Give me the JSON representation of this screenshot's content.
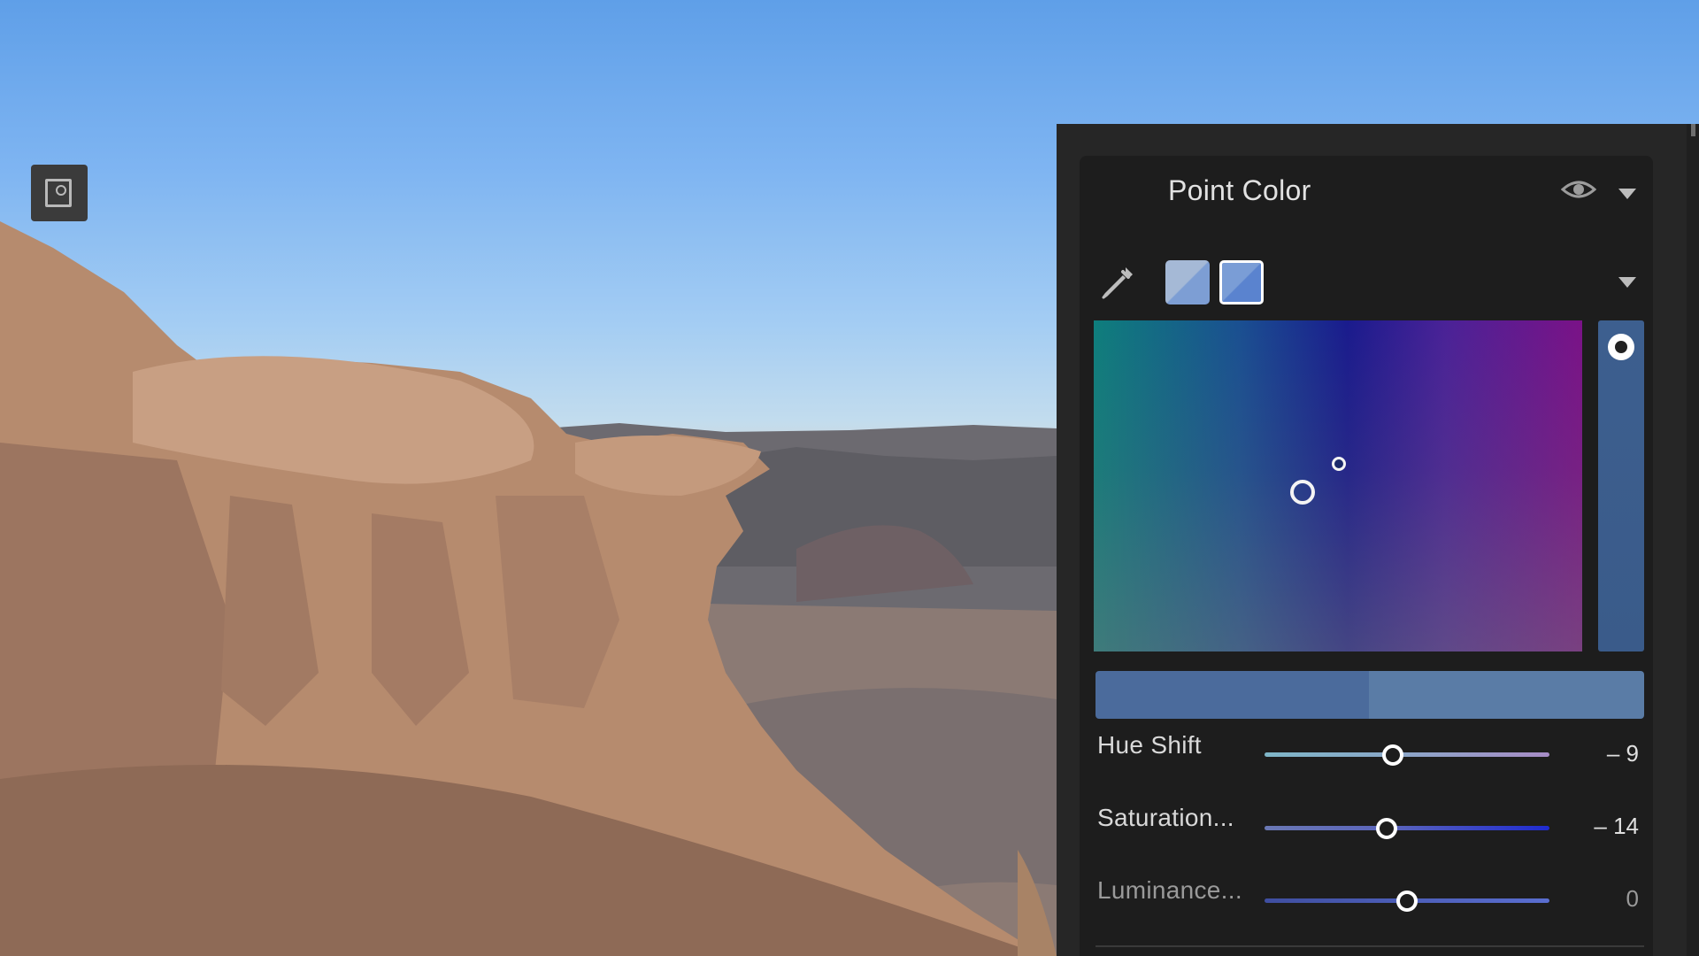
{
  "panel": {
    "title": "Point Color",
    "tool_icon": "point-color-target-icon",
    "visibility_icon": "eye-icon",
    "expand_icon": "chevron-down-icon",
    "eyedropper_icon": "eyedropper-icon",
    "swatch_menu_icon": "chevron-down-icon"
  },
  "swatches": [
    {
      "color_top": "#a5b9d6",
      "color_bottom": "#7d9ed4",
      "selected": false
    },
    {
      "color_top": "#7a9dd6",
      "color_bottom": "#5a83cf",
      "selected": true
    }
  ],
  "preview": {
    "original": "#4b6b9c",
    "adjusted": "#5a7ca6"
  },
  "sliders": [
    {
      "label": "Hue Shift",
      "value": "– 9",
      "level": 0.45
    },
    {
      "label": "Saturation...",
      "value": "– 14",
      "level": 0.43
    },
    {
      "label": "Luminance...",
      "value": "0",
      "level": 0.5
    }
  ],
  "colors": {
    "panel_bg": "#262626",
    "card_bg": "#1d1d1d",
    "text": "#e2e2e2"
  }
}
